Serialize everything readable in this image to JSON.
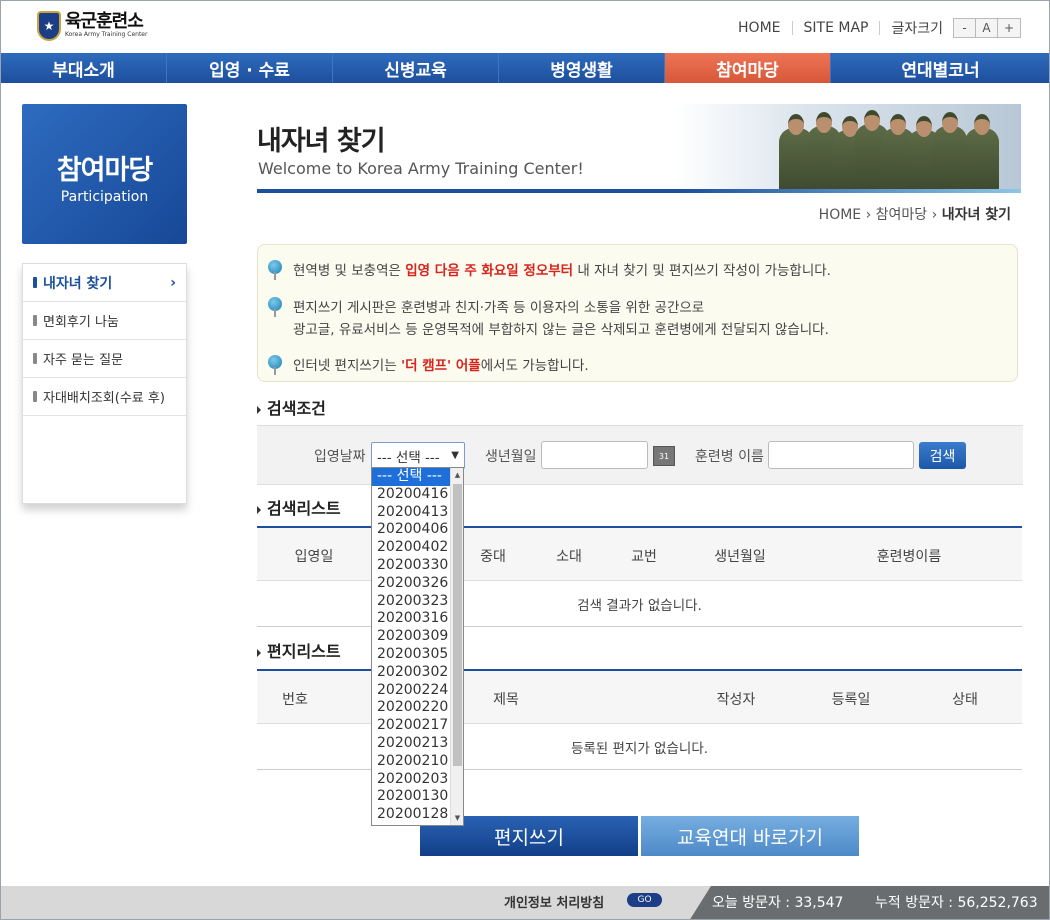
{
  "header": {
    "logo_ko": "육군훈련소",
    "logo_en": "Korea Army Training Center",
    "home": "HOME",
    "sitemap": "SITE MAP",
    "font_size_label": "글자크기",
    "font_minus": "-",
    "font_a": "A",
    "font_plus": "+"
  },
  "gnb": [
    "부대소개",
    "입영 · 수료",
    "신병교육",
    "병영생활",
    "참여마당",
    "연대별코너"
  ],
  "side": {
    "title_ko": "참여마당",
    "title_en": "Participation",
    "items": [
      "내자녀 찾기",
      "면회후기 나눔",
      "자주 묻는 질문",
      "자대배치조회(수료 후)"
    ]
  },
  "page": {
    "title": "내자녀 찾기",
    "subtitle": "Welcome to Korea Army Training Center!",
    "breadcrumb": [
      "HOME",
      "참여마당",
      "내자녀 찾기"
    ]
  },
  "notice": {
    "n1_a": "현역병 및 보충역은 ",
    "n1_b": "입영 다음 주 화요일 정오부터",
    "n1_c": " 내 자녀 찾기 및 편지쓰기 작성이 가능합니다.",
    "n2_a": "편지쓰기 게시판은 훈련병과 친지·가족 등 이용자의 소통을 위한 공간으로",
    "n2_b": "광고글, 유료서비스 등 운영목적에 부합하지 않는 글은 삭제되고 훈련병에게 전달되지 않습니다.",
    "n3_a": "인터넷 편지쓰기는 ",
    "n3_b": "'더 캠프' 어플",
    "n3_c": "에서도 가능합니다."
  },
  "search": {
    "section": "검색조건",
    "date_label": "입영날짜",
    "select_value": "--- 선택 ---",
    "birth_label": "생년월일",
    "name_label": "훈련병 이름",
    "button": "검색",
    "cal": "31"
  },
  "dropdown": {
    "options": [
      "--- 선택 ---",
      "20200416",
      "20200413",
      "20200406",
      "20200402",
      "20200330",
      "20200326",
      "20200323",
      "20200316",
      "20200309",
      "20200305",
      "20200302",
      "20200224",
      "20200220",
      "20200217",
      "20200213",
      "20200210",
      "20200203",
      "20200130",
      "20200128"
    ]
  },
  "result": {
    "section": "검색리스트",
    "cols": [
      "입영일",
      "중대",
      "소대",
      "교번",
      "생년월일",
      "훈련병이름"
    ],
    "empty": "검색 결과가 없습니다."
  },
  "letters": {
    "section": "편지리스트",
    "cols": [
      "번호",
      "제목",
      "작성자",
      "등록일",
      "상태"
    ],
    "empty": "등록된 편지가 없습니다."
  },
  "buttons": {
    "write": "편지쓰기",
    "go_regiment": "교육연대 바로가기"
  },
  "footer": {
    "privacy": "개인정보 처리방침",
    "go": "GO",
    "today": "오늘 방문자 : 33,547",
    "total": "누적 방문자 : 56,252,763"
  }
}
